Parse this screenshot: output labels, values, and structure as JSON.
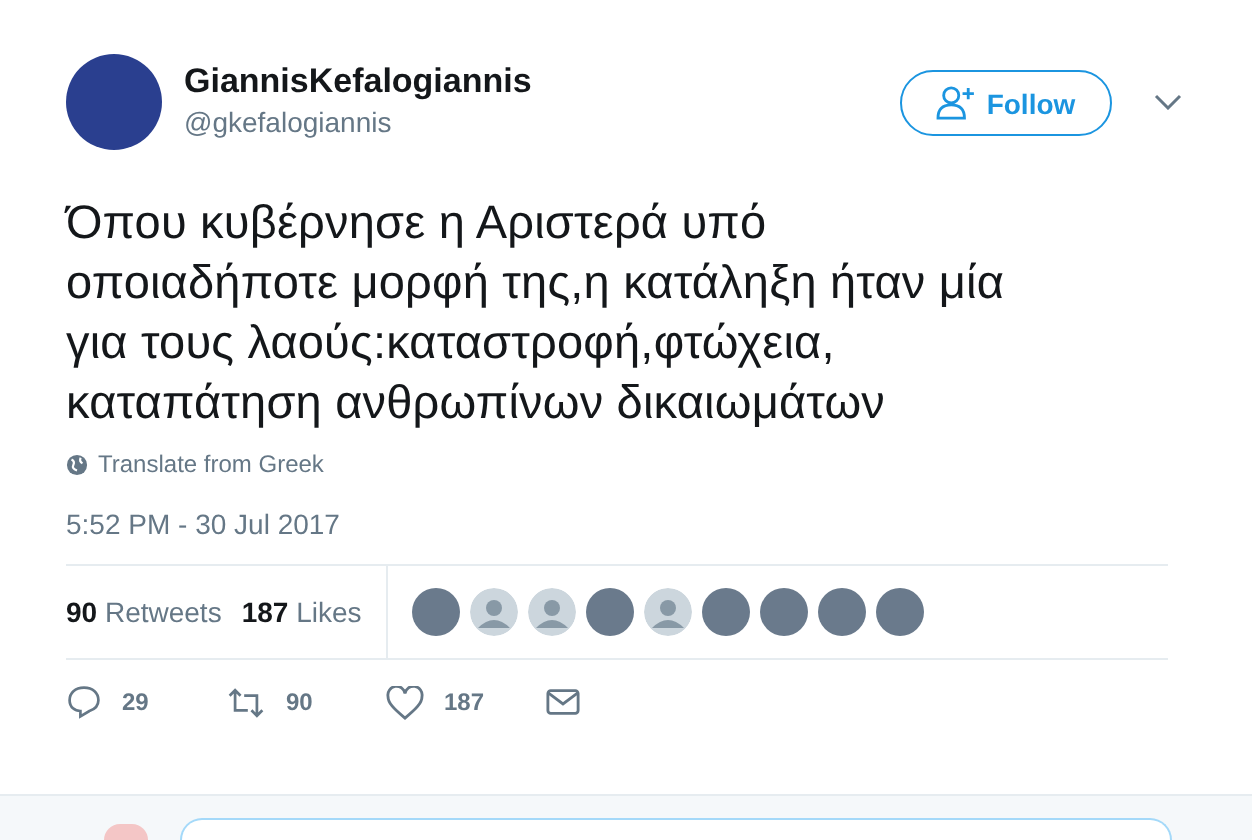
{
  "author": {
    "name": "GiannisKefalogiannis",
    "handle": "@gkefalogiannis"
  },
  "follow_button": {
    "label": "Follow"
  },
  "tweet": {
    "lines": [
      "Όπου κυβέρνησε η Αριστερά υπό",
      "οποιαδήποτε μορφή της,η κατάληξη ήταν μία",
      "για τους λαούς:καταστροφή,φτώχεια,",
      "καταπάτηση ανθρωπίνων δικαιωμάτων"
    ]
  },
  "translate_link": "Translate from Greek",
  "timestamp": "5:52 PM - 30 Jul 2017",
  "stats": [
    {
      "count": "90",
      "label": "Retweets"
    },
    {
      "count": "187",
      "label": "Likes"
    }
  ],
  "likers": [
    {
      "kind": "photo"
    },
    {
      "kind": "default"
    },
    {
      "kind": "default"
    },
    {
      "kind": "photo"
    },
    {
      "kind": "default"
    },
    {
      "kind": "photo"
    },
    {
      "kind": "photo"
    },
    {
      "kind": "photo"
    },
    {
      "kind": "photo"
    }
  ],
  "actions": [
    {
      "kind": "reply",
      "count": "29"
    },
    {
      "kind": "retweet",
      "count": "90"
    },
    {
      "kind": "like",
      "count": "187"
    },
    {
      "kind": "message"
    }
  ]
}
